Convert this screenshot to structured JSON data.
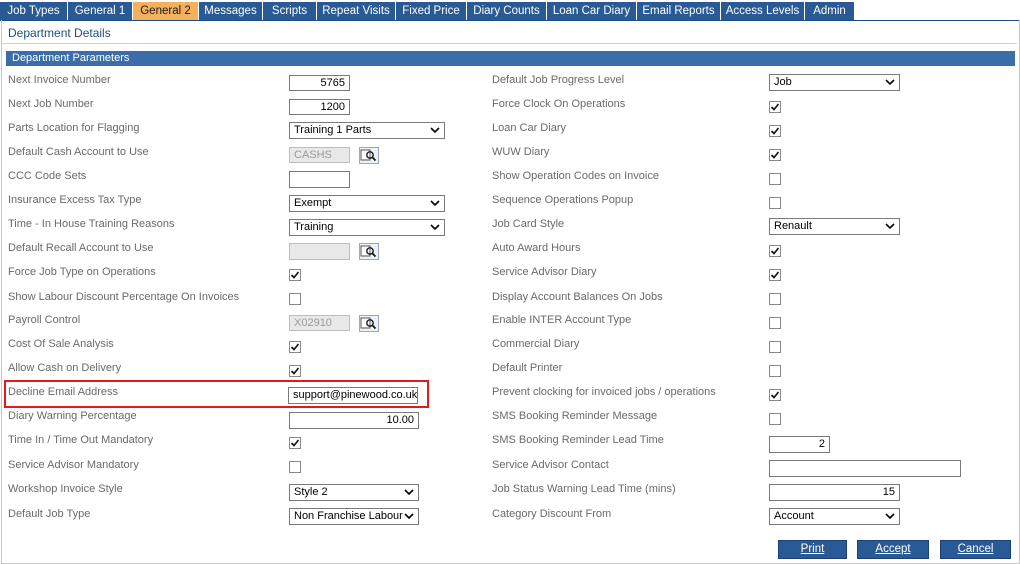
{
  "tabs": [
    "Job Types",
    "General 1",
    "General 2",
    "Messages",
    "Scripts",
    "Repeat Visits",
    "Fixed Price",
    "Diary Counts",
    "Loan Car Diary",
    "Email Reports",
    "Access Levels",
    "Admin"
  ],
  "active_tab": "General 2",
  "page_title": "Department Details",
  "section_title": "Department Parameters",
  "left": {
    "next_invoice_number": {
      "label": "Next Invoice Number",
      "value": "5765"
    },
    "next_job_number": {
      "label": "Next Job Number",
      "value": "1200"
    },
    "parts_location": {
      "label": "Parts Location for Flagging",
      "value": "Training 1 Parts"
    },
    "default_cash_account": {
      "label": "Default Cash Account to Use",
      "value": "CASHS"
    },
    "ccc_code_sets": {
      "label": "CCC Code Sets",
      "value": ""
    },
    "insurance_excess_tax": {
      "label": "Insurance Excess Tax Type",
      "value": "Exempt"
    },
    "time_in_house": {
      "label": "Time - In House Training Reasons",
      "value": "Training"
    },
    "default_recall_account": {
      "label": "Default Recall Account to Use",
      "value": ""
    },
    "force_job_type": {
      "label": "Force Job Type on Operations",
      "checked": true
    },
    "show_labour_discount": {
      "label": "Show Labour Discount Percentage On Invoices",
      "checked": false
    },
    "payroll_control": {
      "label": "Payroll Control",
      "value": "X02910"
    },
    "cost_of_sale": {
      "label": "Cost Of Sale Analysis",
      "checked": true
    },
    "allow_cash": {
      "label": "Allow Cash on Delivery",
      "checked": true
    },
    "decline_email": {
      "label": "Decline Email Address",
      "value": "support@pinewood.co.uk;"
    },
    "diary_warning": {
      "label": "Diary Warning Percentage",
      "value": "10.00"
    },
    "time_in_out": {
      "label": "Time In / Time Out Mandatory",
      "checked": true
    },
    "service_advisor_mandatory": {
      "label": "Service Advisor Mandatory",
      "checked": false
    },
    "workshop_invoice_style": {
      "label": "Workshop Invoice Style",
      "value": "Style 2"
    },
    "default_job_type": {
      "label": "Default Job Type",
      "value": "Non Franchise Labour"
    }
  },
  "right": {
    "default_job_progress": {
      "label": "Default Job Progress Level",
      "value": "Job"
    },
    "force_clock": {
      "label": "Force Clock On Operations",
      "checked": true
    },
    "loan_car_diary": {
      "label": "Loan Car Diary",
      "checked": true
    },
    "wuw_diary": {
      "label": "WUW Diary",
      "checked": true
    },
    "show_operation_codes": {
      "label": "Show Operation Codes on Invoice",
      "checked": false
    },
    "sequence_operations": {
      "label": "Sequence Operations Popup",
      "checked": false
    },
    "job_card_style": {
      "label": "Job Card Style",
      "value": "Renault"
    },
    "auto_award_hours": {
      "label": "Auto Award Hours",
      "checked": true
    },
    "service_advisor_diary": {
      "label": "Service Advisor Diary",
      "checked": true
    },
    "display_account_balances": {
      "label": "Display Account Balances On Jobs",
      "checked": false
    },
    "enable_inter_account": {
      "label": "Enable INTER Account Type",
      "checked": false
    },
    "commercial_diary": {
      "label": "Commercial Diary",
      "checked": false
    },
    "default_printer": {
      "label": "Default Printer",
      "checked": false
    },
    "prevent_clocking": {
      "label": "Prevent clocking for invoiced jobs / operations",
      "checked": true
    },
    "sms_booking_message": {
      "label": "SMS Booking Reminder Message",
      "checked": false
    },
    "sms_lead_time": {
      "label": "SMS Booking Reminder Lead Time",
      "value": "2"
    },
    "service_advisor_contact": {
      "label": "Service Advisor Contact",
      "value": ""
    },
    "job_status_warning": {
      "label": "Job Status Warning Lead Time (mins)",
      "value": "15"
    },
    "category_discount": {
      "label": "Category Discount From",
      "value": "Account"
    }
  },
  "buttons": {
    "print": "Print",
    "accept": "Accept",
    "cancel": "Cancel"
  },
  "colors": {
    "tab_bg": "#2a5a96",
    "tab_active": "#f4b15c",
    "section_bg": "#3b6ea8",
    "highlight": "#e01b1b"
  }
}
